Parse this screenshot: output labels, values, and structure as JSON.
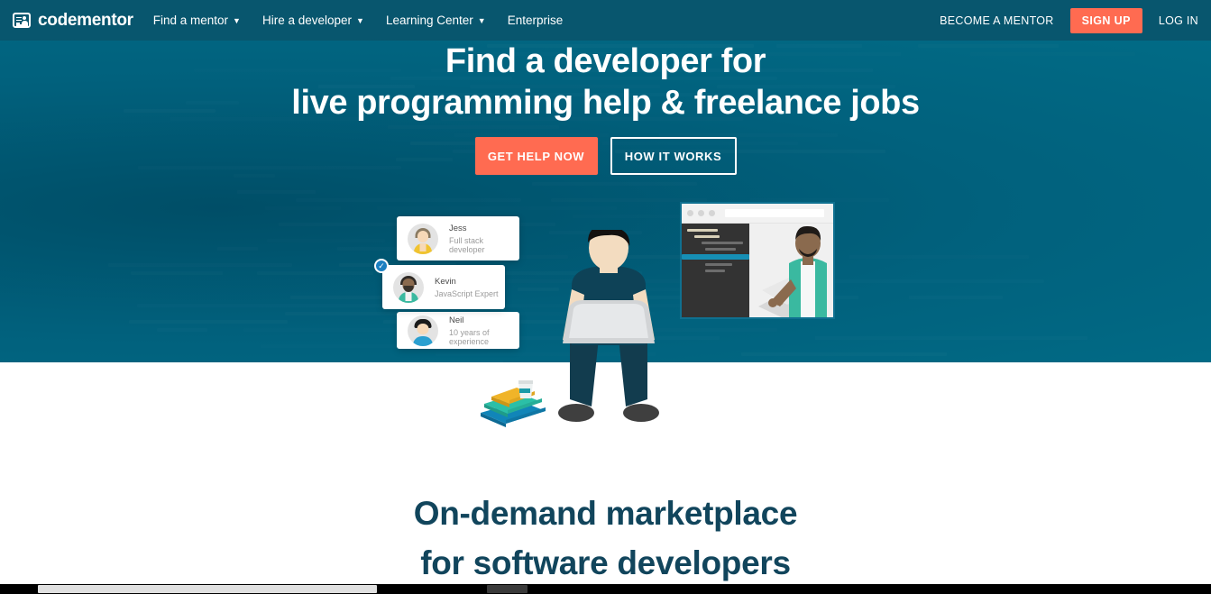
{
  "brand": {
    "name": "codementor",
    "logo_icon": "id-card-icon",
    "accent": "#ff6b51",
    "hero_bg": "#01617d",
    "navbar_bg": "#08566e",
    "heading_color": "#11455c"
  },
  "navbar": {
    "links": [
      {
        "label": "Find a mentor",
        "caret": "⌄",
        "has_caret": true
      },
      {
        "label": "Hire a developer",
        "caret": "⌄",
        "has_caret": true
      },
      {
        "label": "Learning Center",
        "caret": "⌄",
        "has_caret": true
      },
      {
        "label": "Enterprise",
        "caret": "",
        "has_caret": false
      }
    ],
    "become_mentor": "BECOME A MENTOR",
    "sign_up": "SIGN UP",
    "log_in": "LOG IN"
  },
  "hero": {
    "title_line1": "Find a developer for",
    "title_line2": "live programming help & freelance jobs",
    "primary_button": "GET HELP NOW",
    "secondary_button": "HOW IT WORKS"
  },
  "mentor_cards": [
    {
      "name": "Jess",
      "role": "Full stack developer",
      "verified": false
    },
    {
      "name": "Kevin",
      "role": "JavaScript Expert",
      "verified": true
    },
    {
      "name": "Neil",
      "role": "10 years of experience",
      "verified": false
    }
  ],
  "illustration": {
    "browser_window": "browser-window-illustration",
    "developer": "seated-developer-illustration",
    "books": "book-stack-illustration",
    "verified_badge": "check-icon"
  },
  "section2": {
    "title_line1": "On-demand marketplace",
    "title_line2": "for software developers"
  },
  "scrollbar": {
    "orientation": "horizontal"
  }
}
